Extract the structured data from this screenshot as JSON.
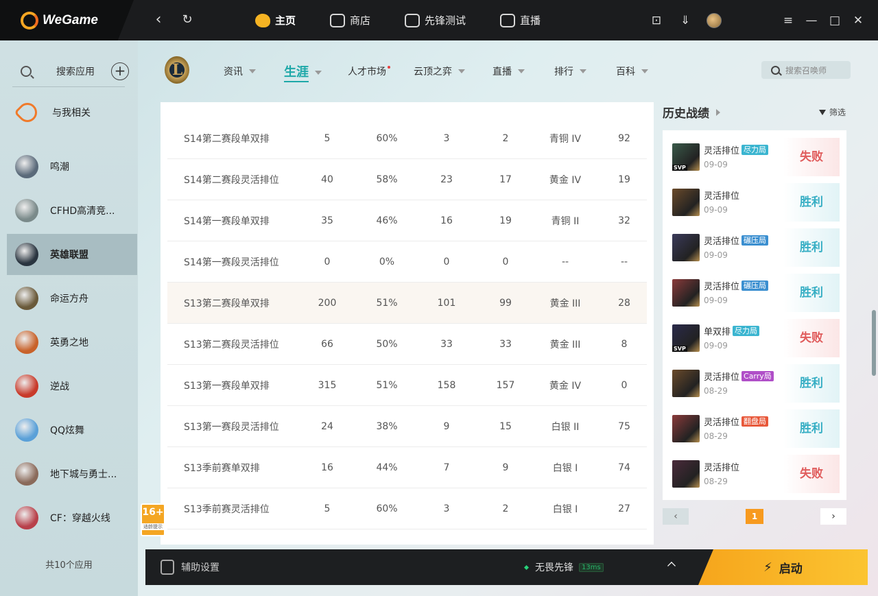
{
  "app": {
    "name": "WeGame"
  },
  "topnav": [
    {
      "label": "主页",
      "active": true
    },
    {
      "label": "商店",
      "active": false
    },
    {
      "label": "先锋测试",
      "active": false
    },
    {
      "label": "直播",
      "active": false
    }
  ],
  "sidebar": {
    "search_label": "搜索应用",
    "related_label": "与我相关",
    "items": [
      {
        "label": "鸣潮",
        "color": "#5a6a7a"
      },
      {
        "label": "CFHD高清竞...",
        "color": "#7a8a8a"
      },
      {
        "label": "英雄联盟",
        "color": "#2a3540",
        "active": true
      },
      {
        "label": "命运方舟",
        "color": "#6a5a3a"
      },
      {
        "label": "英勇之地",
        "color": "#c8622a"
      },
      {
        "label": "逆战",
        "color": "#c83a2a"
      },
      {
        "label": "QQ炫舞",
        "color": "#5aa0d8"
      },
      {
        "label": "地下城与勇士...",
        "color": "#8a6a5a"
      },
      {
        "label": "CF：穿越火线",
        "color": "#b8404a"
      }
    ],
    "footer": "共10个应用"
  },
  "game_tabs": [
    {
      "label": "资讯",
      "caret": true
    },
    {
      "label": "生涯",
      "caret": true,
      "active": true
    },
    {
      "label": "人才市场",
      "dot": true
    },
    {
      "label": "云顶之弈",
      "caret": true
    },
    {
      "label": "直播",
      "caret": true
    },
    {
      "label": "排行",
      "caret": true
    },
    {
      "label": "百科",
      "caret": true
    }
  ],
  "game_search_placeholder": "搜索召唤师",
  "table": {
    "rows": [
      [
        "S14第二赛段单双排",
        "5",
        "60%",
        "3",
        "2",
        "青铜 IV",
        "92"
      ],
      [
        "S14第二赛段灵活排位",
        "40",
        "58%",
        "23",
        "17",
        "黄金 IV",
        "19"
      ],
      [
        "S14第一赛段单双排",
        "35",
        "46%",
        "16",
        "19",
        "青铜 II",
        "32"
      ],
      [
        "S14第一赛段灵活排位",
        "0",
        "0%",
        "0",
        "0",
        "--",
        "--"
      ],
      [
        "S13第二赛段单双排",
        "200",
        "51%",
        "101",
        "99",
        "黄金 III",
        "28"
      ],
      [
        "S13第二赛段灵活排位",
        "66",
        "50%",
        "33",
        "33",
        "黄金 III",
        "8"
      ],
      [
        "S13第一赛段单双排",
        "315",
        "51%",
        "158",
        "157",
        "黄金 IV",
        "0"
      ],
      [
        "S13第一赛段灵活排位",
        "24",
        "38%",
        "9",
        "15",
        "白银 II",
        "75"
      ],
      [
        "S13季前赛单双排",
        "16",
        "44%",
        "7",
        "9",
        "白银 I",
        "74"
      ],
      [
        "S13季前赛灵活排位",
        "5",
        "60%",
        "3",
        "2",
        "白银 I",
        "27"
      ]
    ],
    "highlight_index": 4
  },
  "history": {
    "title": "历史战绩",
    "filter_label": "筛选",
    "items": [
      {
        "mode": "灵活排位",
        "tag": "尽力局",
        "tag_color": "#3bb5d0",
        "date": "09-09",
        "result": "失败",
        "win": false,
        "svp": true,
        "champ_color": "#3a5a4a"
      },
      {
        "mode": "灵活排位",
        "tag": "",
        "tag_color": "",
        "date": "09-09",
        "result": "胜利",
        "win": true,
        "svp": false,
        "champ_color": "#6a4a2a"
      },
      {
        "mode": "灵活排位",
        "tag": "碾压局",
        "tag_color": "#3b8fd0",
        "date": "09-09",
        "result": "胜利",
        "win": true,
        "svp": false,
        "champ_color": "#3a3a5a"
      },
      {
        "mode": "灵活排位",
        "tag": "碾压局",
        "tag_color": "#3b8fd0",
        "date": "09-09",
        "result": "胜利",
        "win": true,
        "svp": false,
        "champ_color": "#8a3a3a"
      },
      {
        "mode": "单双排",
        "tag": "尽力局",
        "tag_color": "#3bb5d0",
        "date": "09-09",
        "result": "失败",
        "win": false,
        "svp": true,
        "champ_color": "#2a2a4a"
      },
      {
        "mode": "灵活排位",
        "tag": "Carry局",
        "tag_color": "#b04fc8",
        "date": "08-29",
        "result": "胜利",
        "win": true,
        "svp": false,
        "champ_color": "#6a4a2a"
      },
      {
        "mode": "灵活排位",
        "tag": "翻盘局",
        "tag_color": "#e8583a",
        "date": "08-29",
        "result": "胜利",
        "win": true,
        "svp": false,
        "champ_color": "#8a3a3a"
      },
      {
        "mode": "灵活排位",
        "tag": "",
        "tag_color": "",
        "date": "08-29",
        "result": "失败",
        "win": false,
        "svp": false,
        "champ_color": "#4a2a3a"
      }
    ]
  },
  "pager": {
    "prev": "‹",
    "page": "1",
    "next": "›"
  },
  "age_badge": {
    "age": "16+",
    "note": "适龄提示"
  },
  "bottom": {
    "assist_label": "辅助设置",
    "accel_label": "无畏先锋",
    "ping": "13ms",
    "launch_label": "启动"
  }
}
